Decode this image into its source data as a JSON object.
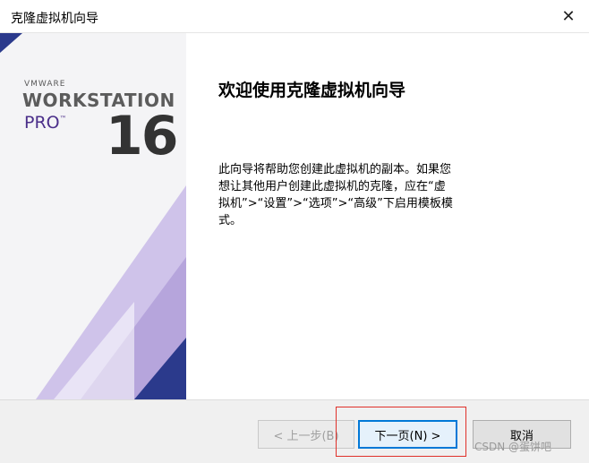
{
  "window": {
    "title": "克隆虚拟机向导",
    "close_symbol": "✕"
  },
  "banner": {
    "brand_vmware": "VMWARE",
    "brand_workstation": "WORKSTATION",
    "brand_pro": "PRO",
    "brand_tm": "™",
    "version": "16",
    "colors": {
      "purple": "#4b2f8a",
      "navy": "#2b3a8c",
      "lavender": "#b6a5dc"
    }
  },
  "main": {
    "heading": "欢迎使用克隆虚拟机向导",
    "description": "此向导将帮助您创建此虚拟机的副本。如果您想让其他用户创建此虚拟机的克隆，应在“虚拟机”>“设置”>“选项”>“高级”下启用模板模式。"
  },
  "footer": {
    "back_label": "< 上一步(B)",
    "next_label": "下一页(N) >",
    "cancel_label": "取消"
  },
  "watermark": "CSDN @蛋饼吧"
}
